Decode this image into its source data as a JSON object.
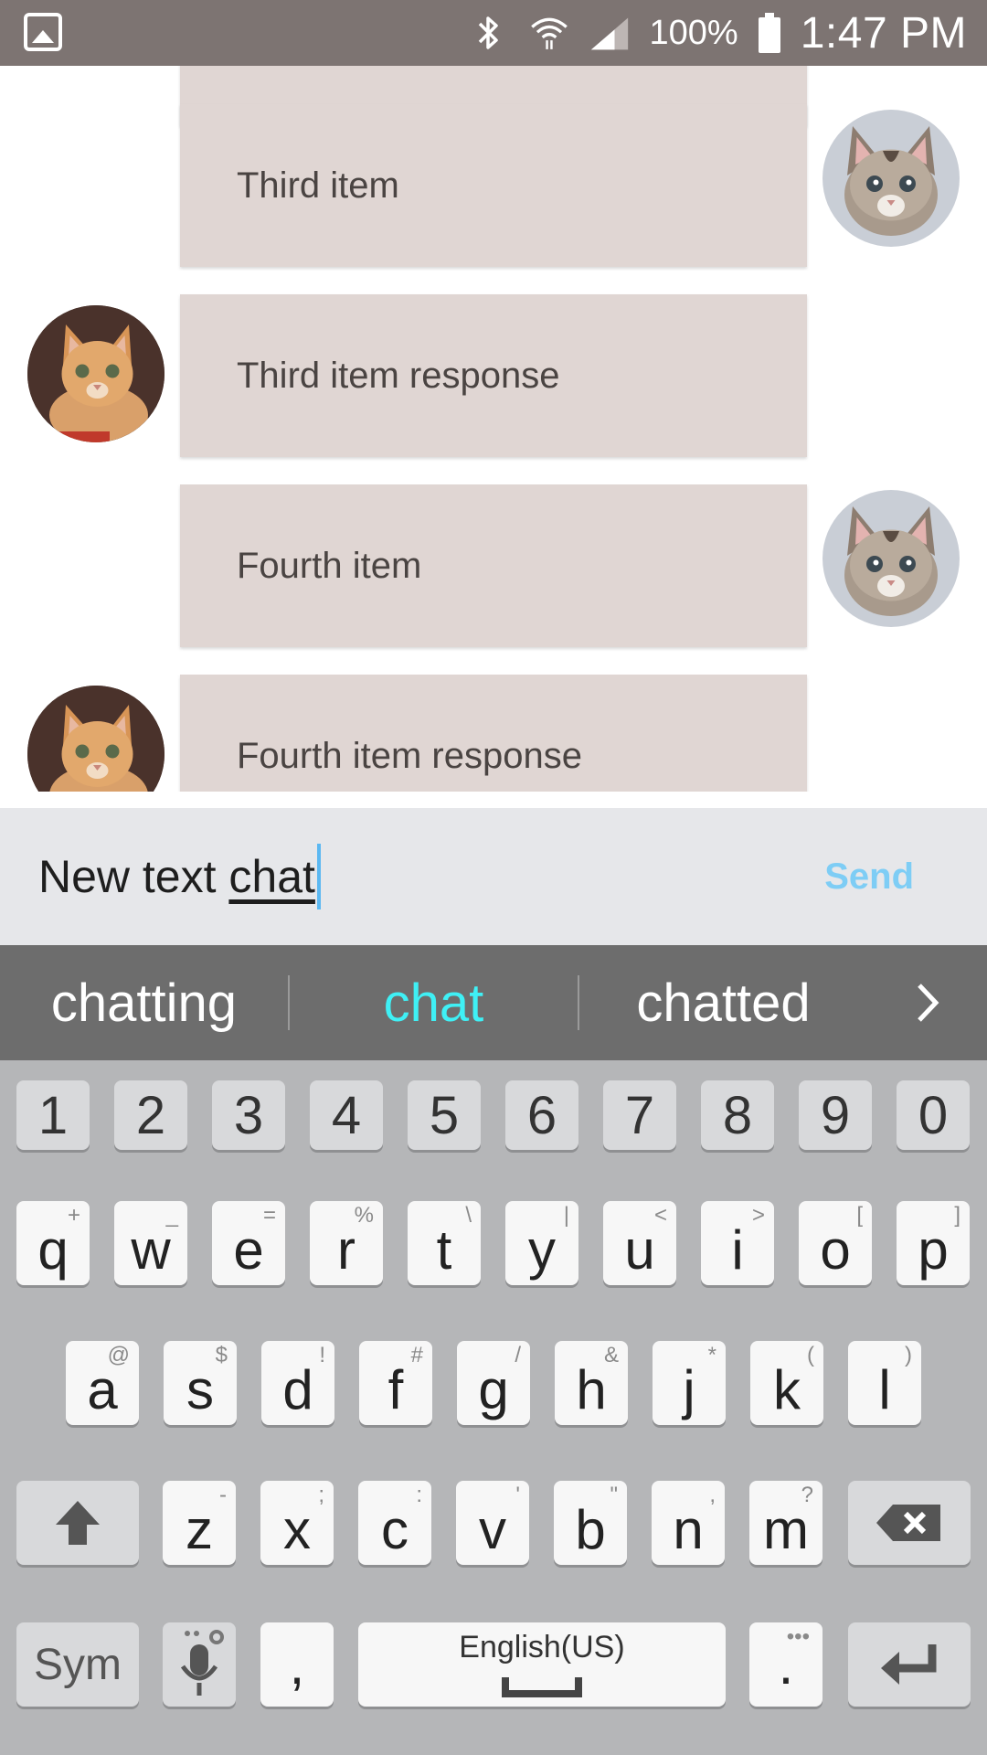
{
  "status_bar": {
    "battery_percent": "100%",
    "time": "1:47 PM"
  },
  "chat": {
    "messages": [
      {
        "text": "",
        "sender": "right"
      },
      {
        "text": "Third item",
        "sender": "right"
      },
      {
        "text": "Third item response",
        "sender": "left"
      },
      {
        "text": "Fourth item",
        "sender": "right"
      },
      {
        "text": "Fourth item response",
        "sender": "left"
      }
    ]
  },
  "composer": {
    "typed_prefix": "New text ",
    "composing_word": "chat",
    "send_label": "Send"
  },
  "suggestions": {
    "items": [
      "chatting",
      "chat",
      "chatted"
    ],
    "selected_index": 1
  },
  "keyboard": {
    "number_row": [
      "1",
      "2",
      "3",
      "4",
      "5",
      "6",
      "7",
      "8",
      "9",
      "0"
    ],
    "row1": [
      {
        "key": "q",
        "hint": "+"
      },
      {
        "key": "w",
        "hint": "_"
      },
      {
        "key": "e",
        "hint": "="
      },
      {
        "key": "r",
        "hint": "%"
      },
      {
        "key": "t",
        "hint": "\\"
      },
      {
        "key": "y",
        "hint": "|"
      },
      {
        "key": "u",
        "hint": "<"
      },
      {
        "key": "i",
        "hint": ">"
      },
      {
        "key": "o",
        "hint": "["
      },
      {
        "key": "p",
        "hint": "]"
      }
    ],
    "row2": [
      {
        "key": "a",
        "hint": "@"
      },
      {
        "key": "s",
        "hint": "$"
      },
      {
        "key": "d",
        "hint": "!"
      },
      {
        "key": "f",
        "hint": "#"
      },
      {
        "key": "g",
        "hint": "/"
      },
      {
        "key": "h",
        "hint": "&"
      },
      {
        "key": "j",
        "hint": "*"
      },
      {
        "key": "k",
        "hint": "("
      },
      {
        "key": "l",
        "hint": ")"
      }
    ],
    "row3": [
      {
        "key": "z",
        "hint": "-"
      },
      {
        "key": "x",
        "hint": ";"
      },
      {
        "key": "c",
        "hint": ":"
      },
      {
        "key": "v",
        "hint": "'"
      },
      {
        "key": "b",
        "hint": "\""
      },
      {
        "key": "n",
        "hint": ","
      },
      {
        "key": "m",
        "hint": "?"
      }
    ],
    "sym_label": "Sym",
    "comma_label": ",",
    "space_label": "English(US)",
    "period_label": "."
  },
  "colors": {
    "status_bar": "#7d7472",
    "bubble": "#e0d6d3",
    "send": "#7ecdf5",
    "suggestion_active": "#3ff0f5",
    "keyboard_bg": "#b5b6b8"
  }
}
